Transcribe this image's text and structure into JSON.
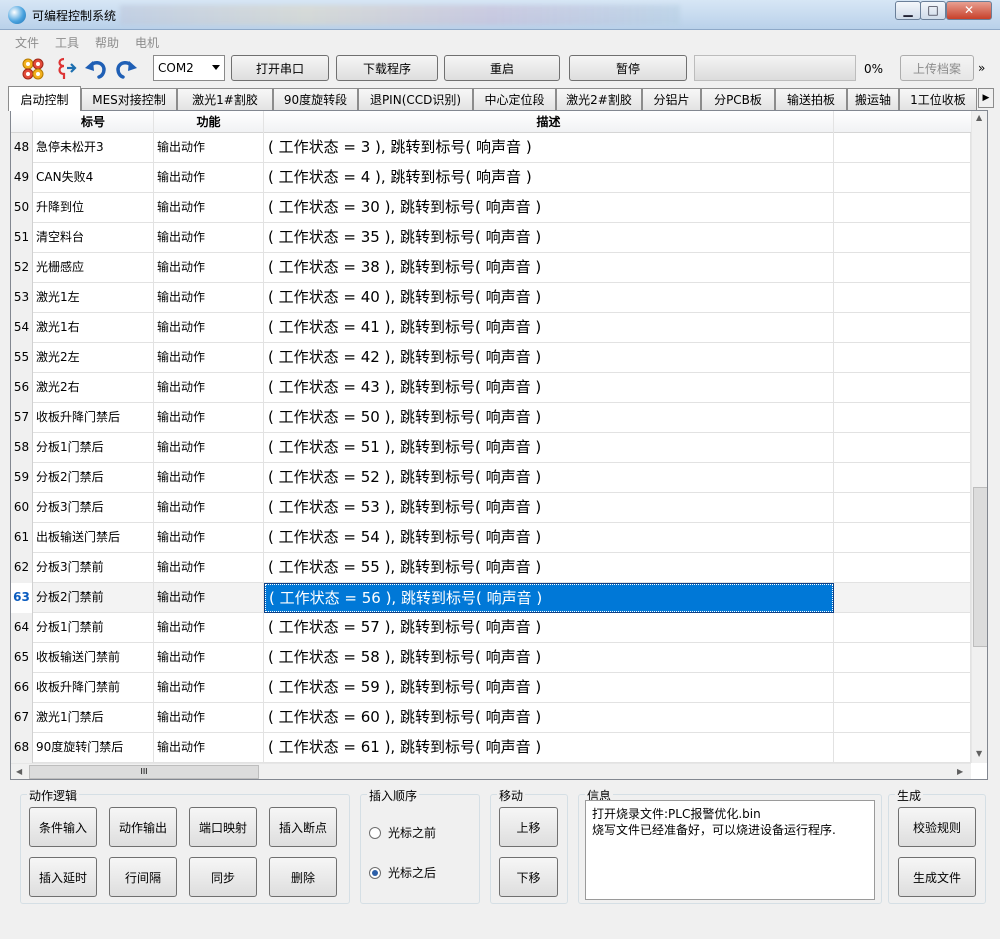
{
  "window": {
    "title": "可编程控制系统",
    "min_symbol": "▁",
    "max_symbol": "□",
    "close_symbol": "✕"
  },
  "menu": [
    "文件",
    "工具",
    "帮助",
    "电机"
  ],
  "toolbar": {
    "icons": [
      "gear-icon",
      "plug-icon",
      "undo-icon",
      "redo-icon"
    ],
    "port_select": "COM2",
    "buttons": [
      "打开串口",
      "下载程序",
      "重启",
      "暂停"
    ],
    "progress_percent": 0,
    "progress_label": "0%",
    "upload_label": "上传档案",
    "more_label": "»"
  },
  "tabs": [
    "启动控制",
    "MES对接控制",
    "激光1#割胶",
    "90度旋转段",
    "退PIN(CCD识别)",
    "中心定位段",
    "激光2#割胶",
    "分铝片",
    "分PCB板",
    "输送拍板",
    "搬运轴",
    "1工位收板"
  ],
  "active_tab_index": 0,
  "grid": {
    "columns": [
      "标号",
      "功能",
      "描述"
    ],
    "selected_index": 15,
    "rows": [
      {
        "num": "48",
        "label": "急停未松开3",
        "func": "输出动作",
        "desc": "( 工作状态 = 3 ), 跳转到标号( 响声音 )"
      },
      {
        "num": "49",
        "label": "CAN失败4",
        "func": "输出动作",
        "desc": "( 工作状态 = 4 ), 跳转到标号( 响声音 )"
      },
      {
        "num": "50",
        "label": "升降到位",
        "func": "输出动作",
        "desc": "( 工作状态 = 30 ), 跳转到标号( 响声音 )"
      },
      {
        "num": "51",
        "label": "清空料台",
        "func": "输出动作",
        "desc": "( 工作状态 = 35 ), 跳转到标号( 响声音 )"
      },
      {
        "num": "52",
        "label": "光栅感应",
        "func": "输出动作",
        "desc": "( 工作状态 = 38 ), 跳转到标号( 响声音 )"
      },
      {
        "num": "53",
        "label": "激光1左",
        "func": "输出动作",
        "desc": "( 工作状态 = 40 ), 跳转到标号( 响声音 )"
      },
      {
        "num": "54",
        "label": "激光1右",
        "func": "输出动作",
        "desc": "( 工作状态 = 41 ), 跳转到标号( 响声音 )"
      },
      {
        "num": "55",
        "label": "激光2左",
        "func": "输出动作",
        "desc": "( 工作状态 = 42 ), 跳转到标号( 响声音 )"
      },
      {
        "num": "56",
        "label": "激光2右",
        "func": "输出动作",
        "desc": "( 工作状态 = 43 ), 跳转到标号( 响声音 )"
      },
      {
        "num": "57",
        "label": "收板升降门禁后",
        "func": "输出动作",
        "desc": "( 工作状态 = 50 ), 跳转到标号( 响声音 )"
      },
      {
        "num": "58",
        "label": "分板1门禁后",
        "func": "输出动作",
        "desc": "( 工作状态 = 51 ), 跳转到标号( 响声音 )"
      },
      {
        "num": "59",
        "label": "分板2门禁后",
        "func": "输出动作",
        "desc": "( 工作状态 = 52 ), 跳转到标号( 响声音 )"
      },
      {
        "num": "60",
        "label": "分板3门禁后",
        "func": "输出动作",
        "desc": "( 工作状态 = 53 ), 跳转到标号( 响声音 )"
      },
      {
        "num": "61",
        "label": "出板输送门禁后",
        "func": "输出动作",
        "desc": "( 工作状态 = 54 ), 跳转到标号( 响声音 )"
      },
      {
        "num": "62",
        "label": "分板3门禁前",
        "func": "输出动作",
        "desc": "( 工作状态 = 55 ), 跳转到标号( 响声音 )"
      },
      {
        "num": "63",
        "label": "分板2门禁前",
        "func": "输出动作",
        "desc": "( 工作状态 = 56 ), 跳转到标号( 响声音 )"
      },
      {
        "num": "64",
        "label": "分板1门禁前",
        "func": "输出动作",
        "desc": "( 工作状态 = 57 ), 跳转到标号( 响声音 )"
      },
      {
        "num": "65",
        "label": "收板输送门禁前",
        "func": "输出动作",
        "desc": "( 工作状态 = 58 ), 跳转到标号( 响声音 )"
      },
      {
        "num": "66",
        "label": "收板升降门禁前",
        "func": "输出动作",
        "desc": "( 工作状态 = 59 ), 跳转到标号( 响声音 )"
      },
      {
        "num": "67",
        "label": "激光1门禁后",
        "func": "输出动作",
        "desc": "( 工作状态 = 60 ), 跳转到标号( 响声音 )"
      },
      {
        "num": "68",
        "label": "90度旋转门禁后",
        "func": "输出动作",
        "desc": "( 工作状态 = 61 ), 跳转到标号( 响声音 )"
      }
    ],
    "hscroll_grip": "III"
  },
  "action_logic": {
    "title": "动作逻辑",
    "buttons": [
      "条件输入",
      "动作输出",
      "端口映射",
      "插入断点",
      "插入延时",
      "行间隔",
      "同步",
      "删除"
    ]
  },
  "insert_order": {
    "title": "插入顺序",
    "options": [
      "光标之前",
      "光标之后"
    ],
    "selected": 1
  },
  "move": {
    "title": "移动",
    "up": "上移",
    "down": "下移"
  },
  "info": {
    "title": "信息",
    "lines": [
      "打开烧录文件:PLC报警优化.bin",
      "烧写文件已经准备好，可以烧进设备运行程序."
    ]
  },
  "generate": {
    "title": "生成",
    "validate": "校验规则",
    "generate": "生成文件"
  }
}
